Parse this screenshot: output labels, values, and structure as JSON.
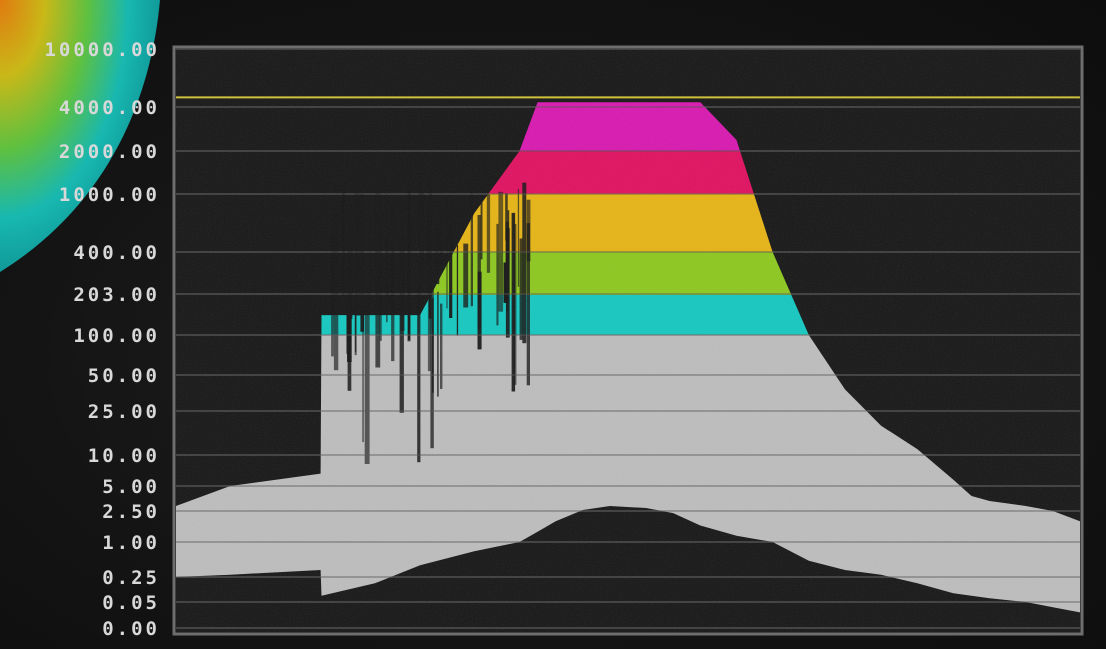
{
  "chart_data": {
    "type": "area",
    "title": "",
    "xlabel": "",
    "ylabel": "",
    "y_scale": "nonlinear (tick-spaced)",
    "ylim": [
      0,
      10000
    ],
    "y_ticks": [
      "10000.00",
      "4000.00",
      "2000.00",
      "1000.00",
      "400.00",
      "203.00",
      "100.00",
      "50.00",
      "25.00",
      "10.00",
      "5.00",
      "2.50",
      "1.00",
      "0.25",
      "0.05",
      "0.00"
    ],
    "reference_line": {
      "value": 5000,
      "color": "#cfc23a"
    },
    "grid": true,
    "color_bands": [
      {
        "from": 100,
        "to": 200,
        "color": "#14c8c0"
      },
      {
        "from": 200,
        "to": 400,
        "color": "#8cc81e"
      },
      {
        "from": 400,
        "to": 1000,
        "color": "#e6b414"
      },
      {
        "from": 1000,
        "to": 2000,
        "color": "#e01060"
      },
      {
        "from": 2000,
        "to": 5000,
        "color": "#d818b0"
      }
    ],
    "base_color": "#bdbdbd",
    "series": [
      {
        "x": [
          0,
          0.06,
          0.16,
          0.161,
          0.22,
          0.27,
          0.33,
          0.38,
          0.4,
          0.42,
          0.45,
          0.48,
          0.52,
          0.55,
          0.58,
          0.62,
          0.66,
          0.7,
          0.74,
          0.78,
          0.82,
          0.86,
          0.88,
          0.9,
          0.94,
          0.97,
          1.0
        ],
        "upper": [
          3,
          5,
          7,
          150,
          150,
          150,
          800,
          2000,
          4500,
          4500,
          4500,
          4500,
          4500,
          4500,
          4500,
          2500,
          400,
          100,
          40,
          20,
          12,
          6,
          4,
          3.5,
          3,
          2.5,
          2
        ],
        "lower": [
          0.25,
          0.3,
          0.4,
          0.1,
          0.2,
          0.5,
          0.8,
          1.0,
          1.5,
          2.0,
          2.6,
          3.0,
          2.8,
          2.4,
          1.8,
          1.3,
          1.0,
          0.6,
          0.4,
          0.3,
          0.2,
          0.12,
          0.1,
          0.08,
          0.05,
          0.04,
          0.03
        ]
      }
    ]
  }
}
